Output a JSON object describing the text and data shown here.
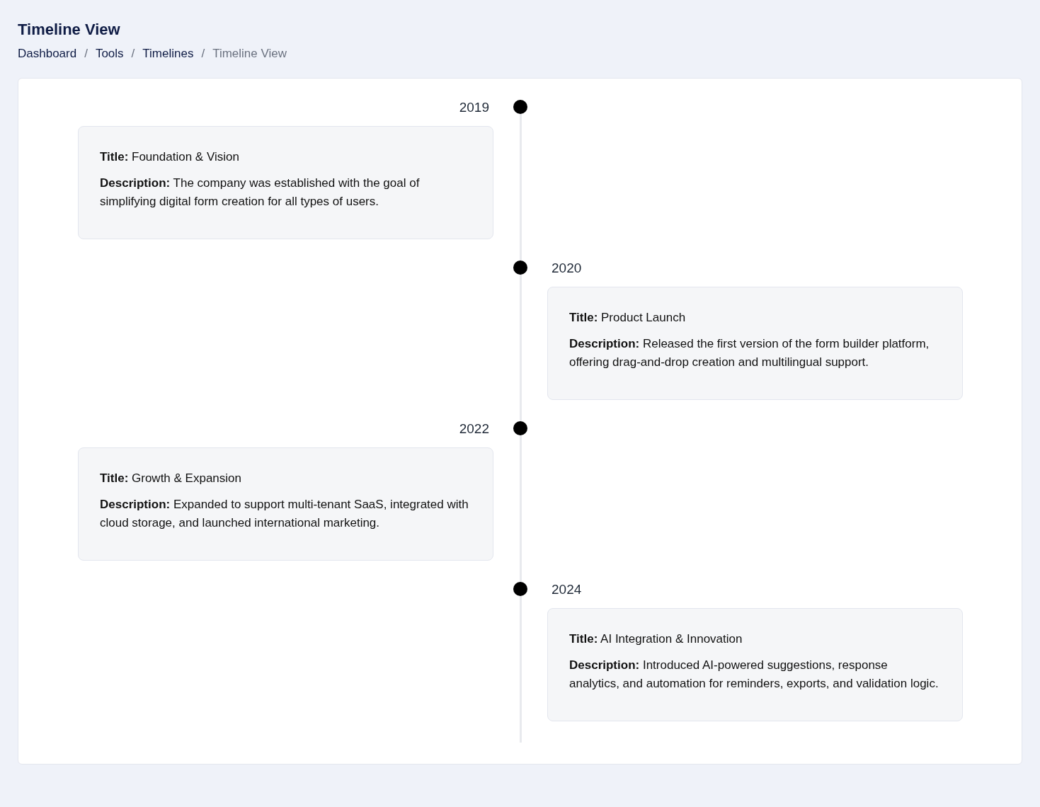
{
  "page_title": "Timeline View",
  "breadcrumb": [
    {
      "kind": "link",
      "text": "Dashboard"
    },
    {
      "kind": "separator",
      "text": "/"
    },
    {
      "kind": "link",
      "text": "Tools"
    },
    {
      "kind": "separator",
      "text": "/"
    },
    {
      "kind": "link",
      "text": "Timelines"
    },
    {
      "kind": "separator",
      "text": "/"
    },
    {
      "kind": "current",
      "text": "Timeline View"
    }
  ],
  "events": [
    {
      "year": "2019",
      "title": "**Title:** Foundation & Vision",
      "description": "**Description:** The company was established with the goal of simplifying digital form creation for all types of users."
    },
    {
      "year": "2020",
      "title": "**Title:** Product Launch",
      "description": "**Description:** Released the first version of the form builder platform, offering drag-and-drop creation and multilingual support."
    },
    {
      "year": "2022",
      "title": "**Title:** Growth & Expansion",
      "description": "**Description:** Expanded to support multi-tenant SaaS, integrated with cloud storage, and launched international marketing."
    },
    {
      "year": "2024",
      "title": "**Title:** AI Integration & Innovation",
      "description": "**Description:** Introduced AI-powered suggestions, response analytics, and automation for reminders, exports, and validation logic."
    }
  ]
}
